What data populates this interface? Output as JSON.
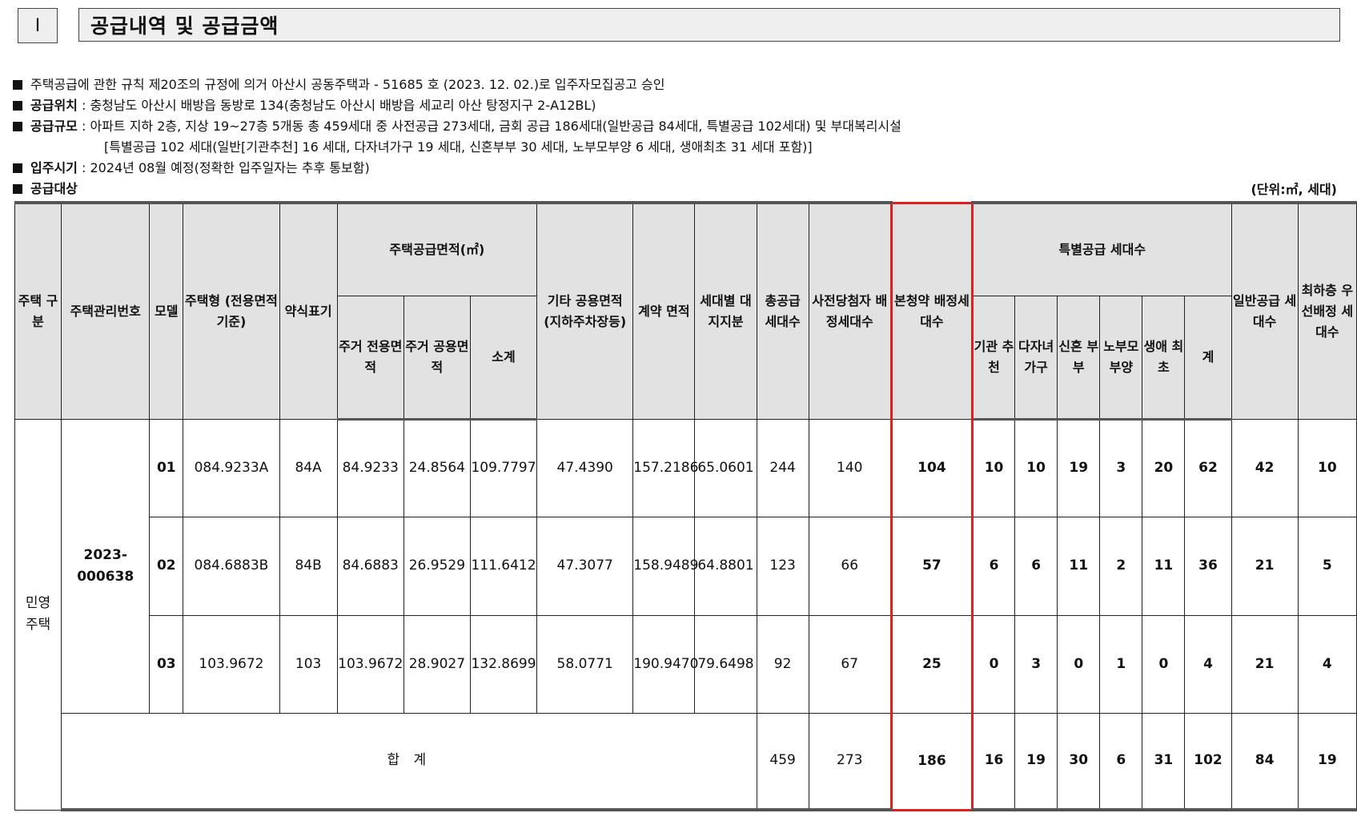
{
  "section": {
    "number": "I",
    "title": "공급내역 및 공급금액"
  },
  "info": [
    {
      "text": "주택공급에 관한 규칙 제20조의 규정에 의거 아산시 공동주택과 - 51685 호 (2023. 12. 02.)로 입주자모집공고 승인"
    },
    {
      "label": "공급위치",
      "text": " : 충청남도 아산시 배방읍 동방로 134(충청남도 아산시 배방읍 세교리 아산 탕정지구 2-A12BL)"
    },
    {
      "label": "공급규모",
      "text": " : 아파트 지하 2층, 지상 19~27층 5개동 총 459세대 중 사전공급 273세대, 금회 공급 186세대(일반공급 84세대, 특별공급  102세대) 및 부대복리시설"
    },
    {
      "text": "[특별공급 102 세대(일반[기관추천] 16 세대, 다자녀가구 19 세대, 신혼부부 30 세대, 노부모부양 6 세대, 생애최초 31 세대 포함)]"
    },
    {
      "label": "입주시기",
      "text": " : 2024년 08월 예정(정확한 입주일자는 추후 통보함)"
    },
    {
      "label": "공급대상",
      "text": ""
    }
  ],
  "unit": "(단위:㎡, 세대)",
  "table": {
    "headers": {
      "housing_type": "주택 구분",
      "mgmt_no": "주택관리번호",
      "model": "모델",
      "house_type": "주택형 (전용면적기준)",
      "short_label": "약식표기",
      "area_group": "주택공급면적(㎡)",
      "excl_area": "주거 전용면적",
      "common_area": "주거 공용면적",
      "subtotal": "소계",
      "other_area": "기타 공용면적 (지하주차장등)",
      "contract_area": "계약 면적",
      "land_share": "세대별 대지지분",
      "total_units": "총공급 세대수",
      "pre_units": "사전당첨자 배정세대수",
      "main_units": "본청약 배정세대수",
      "special_group": "특별공급 세대수",
      "inst": "기관 추천",
      "multi": "다자녀 가구",
      "newlywed": "신혼 부부",
      "elderly": "노부모 부양",
      "first": "생애 최초",
      "sum": "계",
      "general": "일반공급 세대수",
      "lowest": "최하층 우선배정 세대수"
    },
    "housing_type_value": "민영 주택",
    "mgmt_no_value": "2023-000638",
    "rows": [
      [
        "01",
        "084.9233A",
        "84A",
        "84.9233",
        "24.8564",
        "109.7797",
        "47.4390",
        "157.2186",
        "65.0601",
        "244",
        "140",
        "104",
        "10",
        "10",
        "19",
        "3",
        "20",
        "62",
        "42",
        "10"
      ],
      [
        "02",
        "084.6883B",
        "84B",
        "84.6883",
        "26.9529",
        "111.6412",
        "47.3077",
        "158.9489",
        "64.8801",
        "123",
        "66",
        "57",
        "6",
        "6",
        "11",
        "2",
        "11",
        "36",
        "21",
        "5"
      ],
      [
        "03",
        "103.9672",
        "103",
        "103.9672",
        "28.9027",
        "132.8699",
        "58.0771",
        "190.9470",
        "79.6498",
        "92",
        "67",
        "25",
        "0",
        "3",
        "0",
        "1",
        "0",
        "4",
        "21",
        "4"
      ]
    ],
    "total": {
      "label": "합 계",
      "values": [
        "459",
        "273",
        "186",
        "16",
        "19",
        "30",
        "6",
        "31",
        "102",
        "84",
        "19"
      ]
    }
  },
  "colors": {
    "highlight_border": "#e02020",
    "header_bg": "#e2e2e2"
  }
}
